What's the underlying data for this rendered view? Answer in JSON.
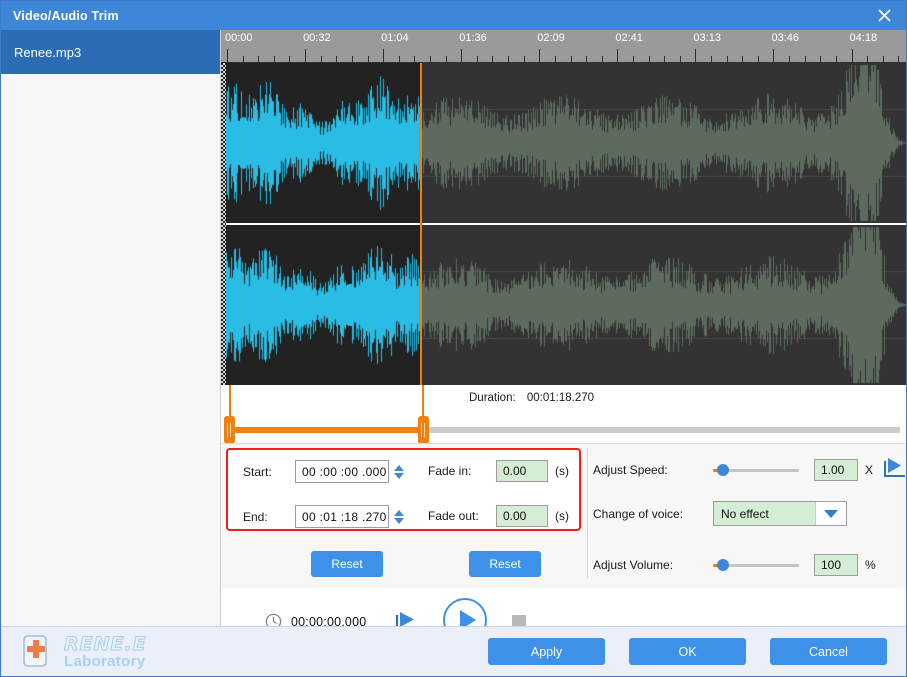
{
  "window": {
    "title": "Video/Audio Trim",
    "close_icon": "close-icon"
  },
  "sidebar": {
    "items": [
      {
        "label": "Renee.mp3",
        "selected": true
      }
    ]
  },
  "timeline": {
    "ticks": [
      "00:00",
      "00:32",
      "01:04",
      "01:36",
      "02:09",
      "02:41",
      "03:13",
      "03:46",
      "04:18"
    ],
    "playhead_position_percent": 29.0,
    "selection_start_percent": 0.0,
    "selection_end_percent": 29.0
  },
  "duration": {
    "label": "Duration:",
    "value": "00:01:18.270"
  },
  "trim": {
    "start_label": "Start:",
    "start_value": "00 :00 :00 .000",
    "end_label": "End:",
    "end_value": "00 :01 :18 .270",
    "reset_label": "Reset"
  },
  "fade": {
    "in_label": "Fade in:",
    "in_value": "0.00",
    "out_label": "Fade out:",
    "out_value": "0.00",
    "unit": "(s)",
    "reset_label": "Reset"
  },
  "effects": {
    "speed_label": "Adjust Speed:",
    "speed_value": "1.00",
    "speed_unit": "X",
    "speed_percent": 12,
    "speed_preview_icon": "play-preview-icon",
    "voice_label": "Change of voice:",
    "voice_value": "No effect",
    "voice_caret_icon": "chevron-down-icon",
    "volume_label": "Adjust Volume:",
    "volume_value": "100",
    "volume_unit": "%",
    "volume_percent": 12
  },
  "transport": {
    "clock_icon": "clock-icon",
    "timecode": "00:00:00.000",
    "preview_icon": "play-to-marker-icon",
    "play_icon": "play-circle-icon",
    "stop_icon": "stop-icon"
  },
  "footer": {
    "logo_line1": "RENE.E",
    "logo_line2": "Laboratory",
    "logo_icon": "renee-cross-logo-icon",
    "apply_label": "Apply",
    "ok_label": "OK",
    "cancel_label": "Cancel"
  },
  "colors": {
    "title_blue": "#3d86d8",
    "sidebar_selected": "#2b6cb5",
    "button_blue": "#3d91e8",
    "accent_orange": "#f08010",
    "highlight_red": "#f11d1d",
    "field_green": "#d4edd4",
    "waveform_selected": "#29bde5",
    "waveform_unselected": "#5d6b5f"
  }
}
